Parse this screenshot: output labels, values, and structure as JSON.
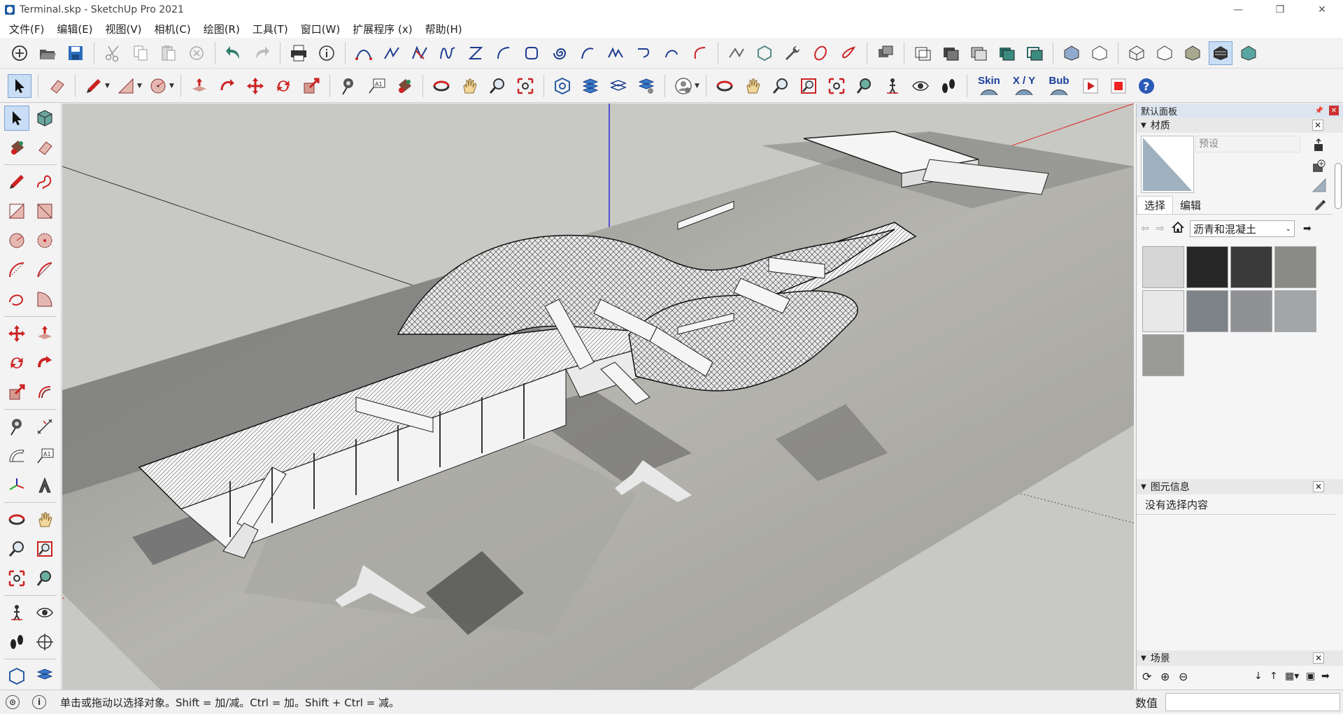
{
  "window": {
    "title": "Terminal.skp - SketchUp Pro 2021",
    "minimize": "—",
    "maximize": "❐",
    "close": "✕"
  },
  "menubar": {
    "items": [
      "文件(F)",
      "编辑(E)",
      "视图(V)",
      "相机(C)",
      "绘图(R)",
      "工具(T)",
      "窗口(W)",
      "扩展程序 (x)",
      "帮助(H)"
    ]
  },
  "toolbar_plugins": {
    "skin": "Skin",
    "xy": "X / Y",
    "bub": "Bub"
  },
  "panel": {
    "tray_title": "默认面板",
    "materials": {
      "header": "材质",
      "preset_label": "预设",
      "tabs": [
        "选择",
        "编辑"
      ],
      "library": "沥青和混凝土",
      "swatch_colors": [
        "#d6d6d6",
        "#262626",
        "#3b3a3a",
        "#8a8a86",
        "#e8e8e8",
        "#7d8388",
        "#8f9194",
        "#a3a6a8",
        "#9a9a98"
      ]
    },
    "entity_info": {
      "header": "图元信息",
      "empty_text": "没有选择内容"
    },
    "scenes": {
      "header": "场景"
    }
  },
  "status": {
    "hint": "单击或拖动以选择对象。Shift = 加/减。Ctrl = 加。Shift + Ctrl = 减。",
    "value_label": "数值"
  },
  "colors": {
    "viewport_bg": "#c8c8c4",
    "axis_blue": "#2b2bd1",
    "axis_red": "#d22",
    "selection_blue": "#c9def5"
  }
}
